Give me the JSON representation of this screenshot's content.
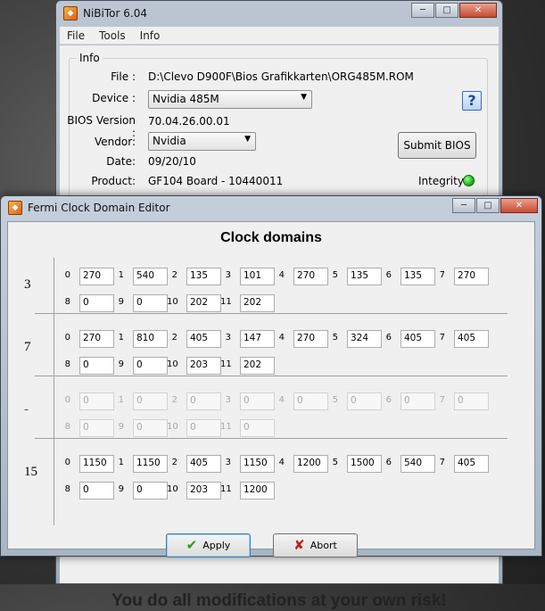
{
  "main_window": {
    "title": "NiBiTor 6.04",
    "menu": [
      "File",
      "Tools",
      "Info"
    ],
    "info_group": "Info",
    "file_label": "File :",
    "file_value": "D:\\Clevo D900F\\Bios Grafikkarten\\ORG485M.ROM",
    "device_label": "Device :",
    "device_value": "Nvidia 485M",
    "bios_version_label": "BIOS Version :",
    "bios_version_value": "70.04.26.00.01",
    "vendor_label": "Vendor:",
    "vendor_value": "Nvidia",
    "date_label": "Date:",
    "date_value": "09/20/10",
    "product_label": "Product:",
    "product_value": "GF104 Board - 10440011",
    "submit_bios": "Submit BIOS",
    "integrity_label": "Integrity :",
    "integrity_color": "#1db51c",
    "help_icon": "?",
    "disclaimer": "You do all modifications at your own risk!"
  },
  "dialog": {
    "title": "Fermi Clock Domain Editor",
    "heading": "Clock domains",
    "apply_label": "Apply",
    "abort_label": "Abort",
    "sections": [
      {
        "label": "3",
        "enabled": true,
        "indices": [
          "0",
          "1",
          "2",
          "3",
          "4",
          "5",
          "6",
          "7",
          "8",
          "9",
          "10",
          "11"
        ],
        "values": [
          "270",
          "540",
          "135",
          "101",
          "270",
          "135",
          "135",
          "270",
          "0",
          "0",
          "202",
          "202"
        ]
      },
      {
        "label": "7",
        "enabled": true,
        "indices": [
          "0",
          "1",
          "2",
          "3",
          "4",
          "5",
          "6",
          "7",
          "8",
          "9",
          "10",
          "11"
        ],
        "values": [
          "270",
          "810",
          "405",
          "147",
          "270",
          "324",
          "405",
          "405",
          "0",
          "0",
          "203",
          "202"
        ]
      },
      {
        "label": "-",
        "enabled": false,
        "indices": [
          "0",
          "1",
          "2",
          "3",
          "4",
          "5",
          "6",
          "7",
          "8",
          "9",
          "10",
          "11"
        ],
        "values": [
          "0",
          "0",
          "0",
          "0",
          "0",
          "0",
          "0",
          "0",
          "0",
          "0",
          "0",
          "0"
        ]
      },
      {
        "label": "15",
        "enabled": true,
        "indices": [
          "0",
          "1",
          "2",
          "3",
          "4",
          "5",
          "6",
          "7",
          "8",
          "9",
          "10",
          "11"
        ],
        "values": [
          "1150",
          "1150",
          "405",
          "1150",
          "1200",
          "1500",
          "540",
          "405",
          "0",
          "0",
          "203",
          "1200"
        ]
      }
    ]
  }
}
